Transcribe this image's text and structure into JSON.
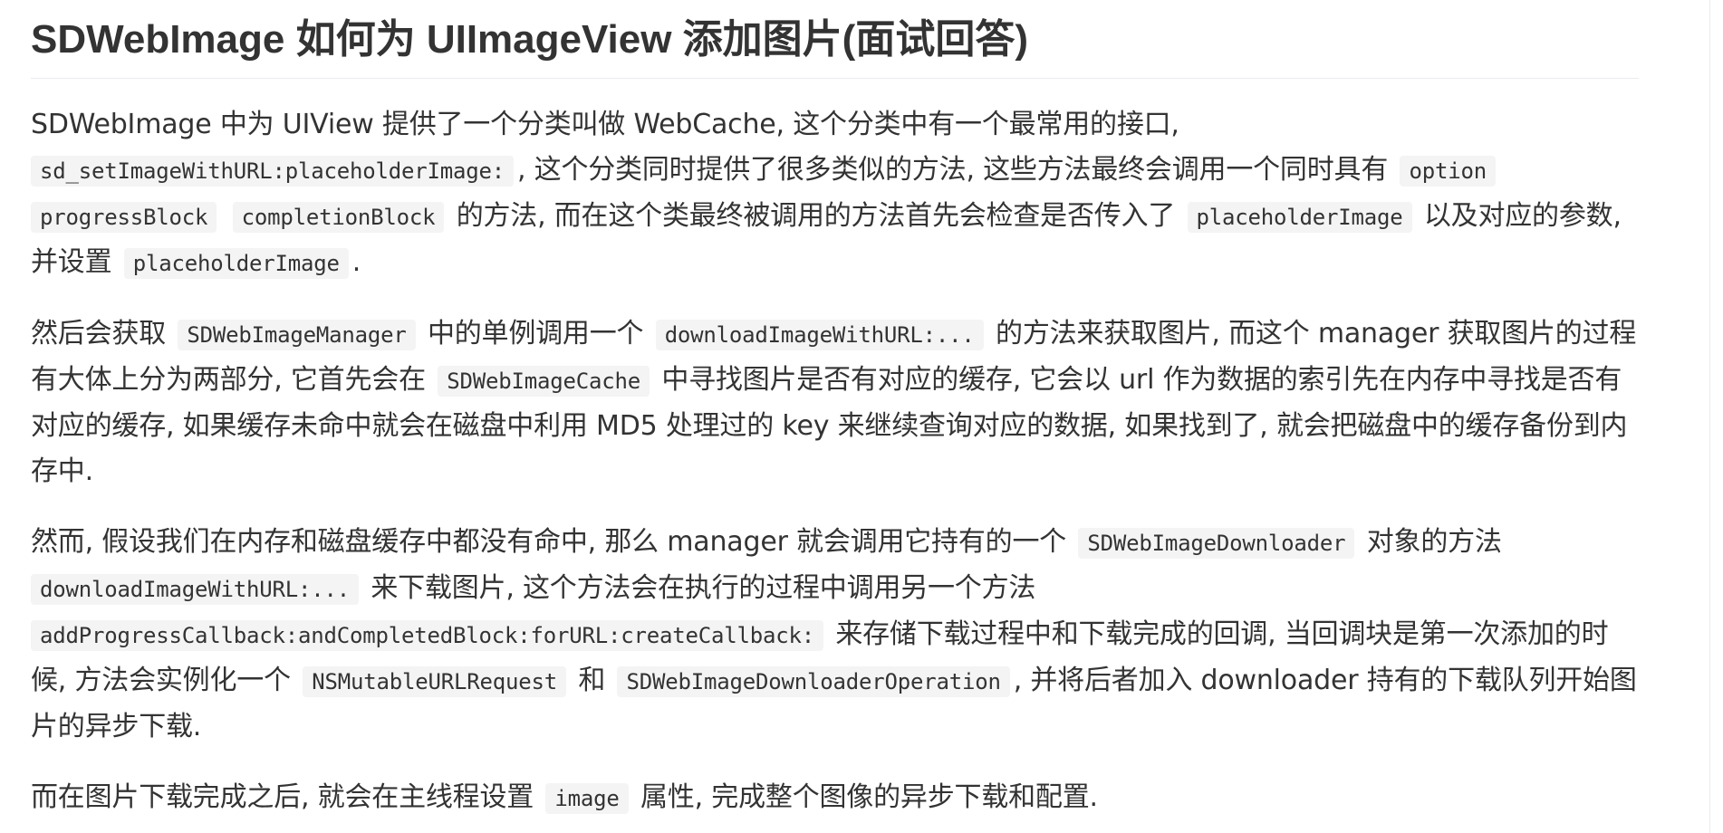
{
  "title": "SDWebImage 如何为 UIImageView 添加图片(面试回答)",
  "p1": {
    "t1": "SDWebImage 中为 UIView 提供了一个分类叫做 WebCache, 这个分类中有一个最常用的接口,",
    "c1": "sd_setImageWithURL:placeholderImage:",
    "t2": ", 这个分类同时提供了很多类似的方法, 这些方法最终会调用一个同时具有",
    "c2": "option",
    "c3": "progressBlock",
    "c4": "completionBlock",
    "t3": "的方法, 而在这个类最终被调用的方法首先会检查是否传入了",
    "c5": "placeholderImage",
    "t4": "以及对应的参数, 并设置",
    "c6": "placeholderImage",
    "t5": "."
  },
  "p2": {
    "t1": "然后会获取",
    "c1": "SDWebImageManager",
    "t2": "中的单例调用一个",
    "c2": "downloadImageWithURL:...",
    "t3": "的方法来获取图片, 而这个 manager 获取图片的过程有大体上分为两部分, 它首先会在",
    "c3": "SDWebImageCache",
    "t4": "中寻找图片是否有对应的缓存, 它会以 url 作为数据的索引先在内存中寻找是否有对应的缓存, 如果缓存未命中就会在磁盘中利用 MD5 处理过的 key 来继续查询对应的数据, 如果找到了, 就会把磁盘中的缓存备份到内存中."
  },
  "p3": {
    "t1": "然而, 假设我们在内存和磁盘缓存中都没有命中, 那么 manager 就会调用它持有的一个",
    "c1": "SDWebImageDownloader",
    "t2": "对象的方法",
    "c2": "downloadImageWithURL:...",
    "t3": "来下载图片, 这个方法会在执行的过程中调用另一个方法",
    "c3": "addProgressCallback:andCompletedBlock:forURL:createCallback:",
    "t4": "来存储下载过程中和下载完成的回调, 当回调块是第一次添加的时候, 方法会实例化一个",
    "c4": "NSMutableURLRequest",
    "t5": "和",
    "c5": "SDWebImageDownloaderOperation",
    "t6": ", 并将后者加入 downloader 持有的下载队列开始图片的异步下载."
  },
  "p4": {
    "t1": "而在图片下载完成之后, 就会在主线程设置",
    "c1": "image",
    "t2": "属性, 完成整个图像的异步下载和配置."
  }
}
